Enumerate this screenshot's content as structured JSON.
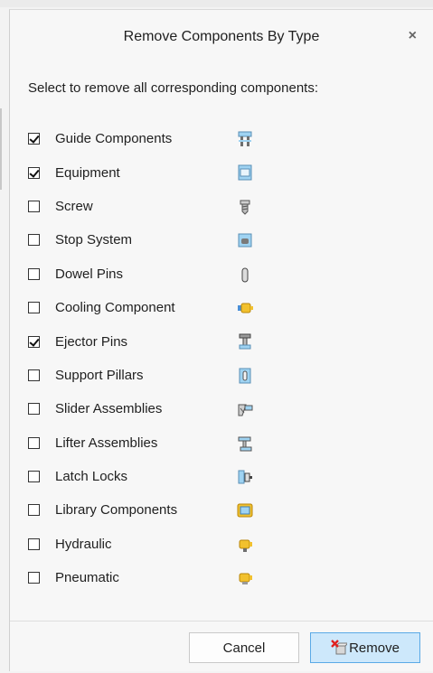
{
  "dialog": {
    "title": "Remove Components By Type",
    "close_glyph": "×",
    "instruction": "Select to remove all corresponding components:"
  },
  "items": [
    {
      "label": "Guide Components",
      "checked": true,
      "icon": "guide-components-icon"
    },
    {
      "label": "Equipment",
      "checked": true,
      "icon": "equipment-icon"
    },
    {
      "label": "Screw",
      "checked": false,
      "icon": "screw-icon"
    },
    {
      "label": "Stop System",
      "checked": false,
      "icon": "stop-system-icon"
    },
    {
      "label": "Dowel Pins",
      "checked": false,
      "icon": "dowel-pin-icon"
    },
    {
      "label": "Cooling Component",
      "checked": false,
      "icon": "cooling-component-icon"
    },
    {
      "label": "Ejector Pins",
      "checked": true,
      "icon": "ejector-pin-icon"
    },
    {
      "label": "Support Pillars",
      "checked": false,
      "icon": "support-pillar-icon"
    },
    {
      "label": "Slider Assemblies",
      "checked": false,
      "icon": "slider-assembly-icon"
    },
    {
      "label": "Lifter Assemblies",
      "checked": false,
      "icon": "lifter-assembly-icon"
    },
    {
      "label": "Latch Locks",
      "checked": false,
      "icon": "latch-lock-icon"
    },
    {
      "label": "Library Components",
      "checked": false,
      "icon": "library-component-icon"
    },
    {
      "label": "Hydraulic",
      "checked": false,
      "icon": "hydraulic-icon"
    },
    {
      "label": "Pneumatic",
      "checked": false,
      "icon": "pneumatic-icon"
    }
  ],
  "buttons": {
    "cancel_label": "Cancel",
    "remove_label": "Remove"
  },
  "colors": {
    "accent_blue": "#5aa9e6",
    "remove_button_bg": "#cde8fb",
    "icon_light_blue": "#9fd3f2",
    "icon_yellow": "#f2c12e"
  }
}
